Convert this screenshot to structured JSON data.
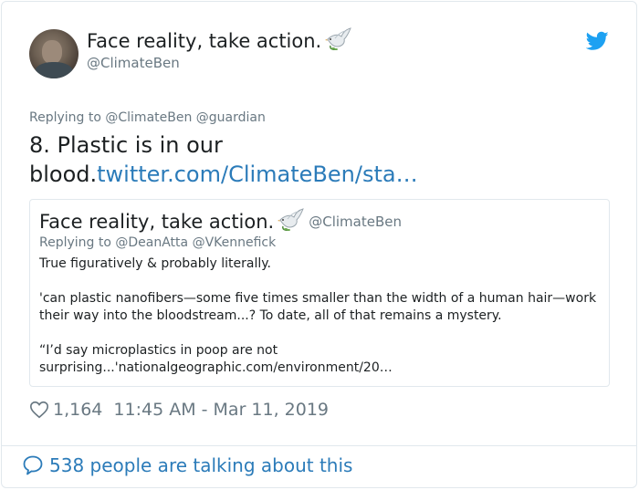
{
  "author": {
    "name": "Face reality, take action.",
    "handle": "@ClimateBen",
    "avatar_icon": "avatar-photo",
    "emoji_icon": "dove-icon"
  },
  "brand_icon": "twitter-bird-icon",
  "tweet": {
    "replying_to": "Replying to @ClimateBen @guardian",
    "text": "8. Plastic is in our blood.",
    "link": "twitter.com/ClimateBen/sta…"
  },
  "quoted_tweet": {
    "name": "Face reality, take action.",
    "handle": "@ClimateBen",
    "replying_to": "Replying to @DeanAtta @VKennefick",
    "paragraphs": [
      "True figuratively & probably literally.",
      "'can plastic nanofibers—some five times smaller than the width of a human hair—work their way into the bloodstream...? To date, all of that remains a mystery.",
      "“I’d say microplastics in poop are not surprising...'nationalgeographic.com/environment/20…"
    ]
  },
  "meta": {
    "likes": "1,164",
    "timestamp": "11:45 AM - Mar 11, 2019"
  },
  "footer": {
    "talking": "538 people are talking about this"
  },
  "colors": {
    "link": "#2b7bb9",
    "secondary_text": "#697882",
    "twitter_blue": "#1da1f2",
    "border": "#e1e8ed"
  }
}
